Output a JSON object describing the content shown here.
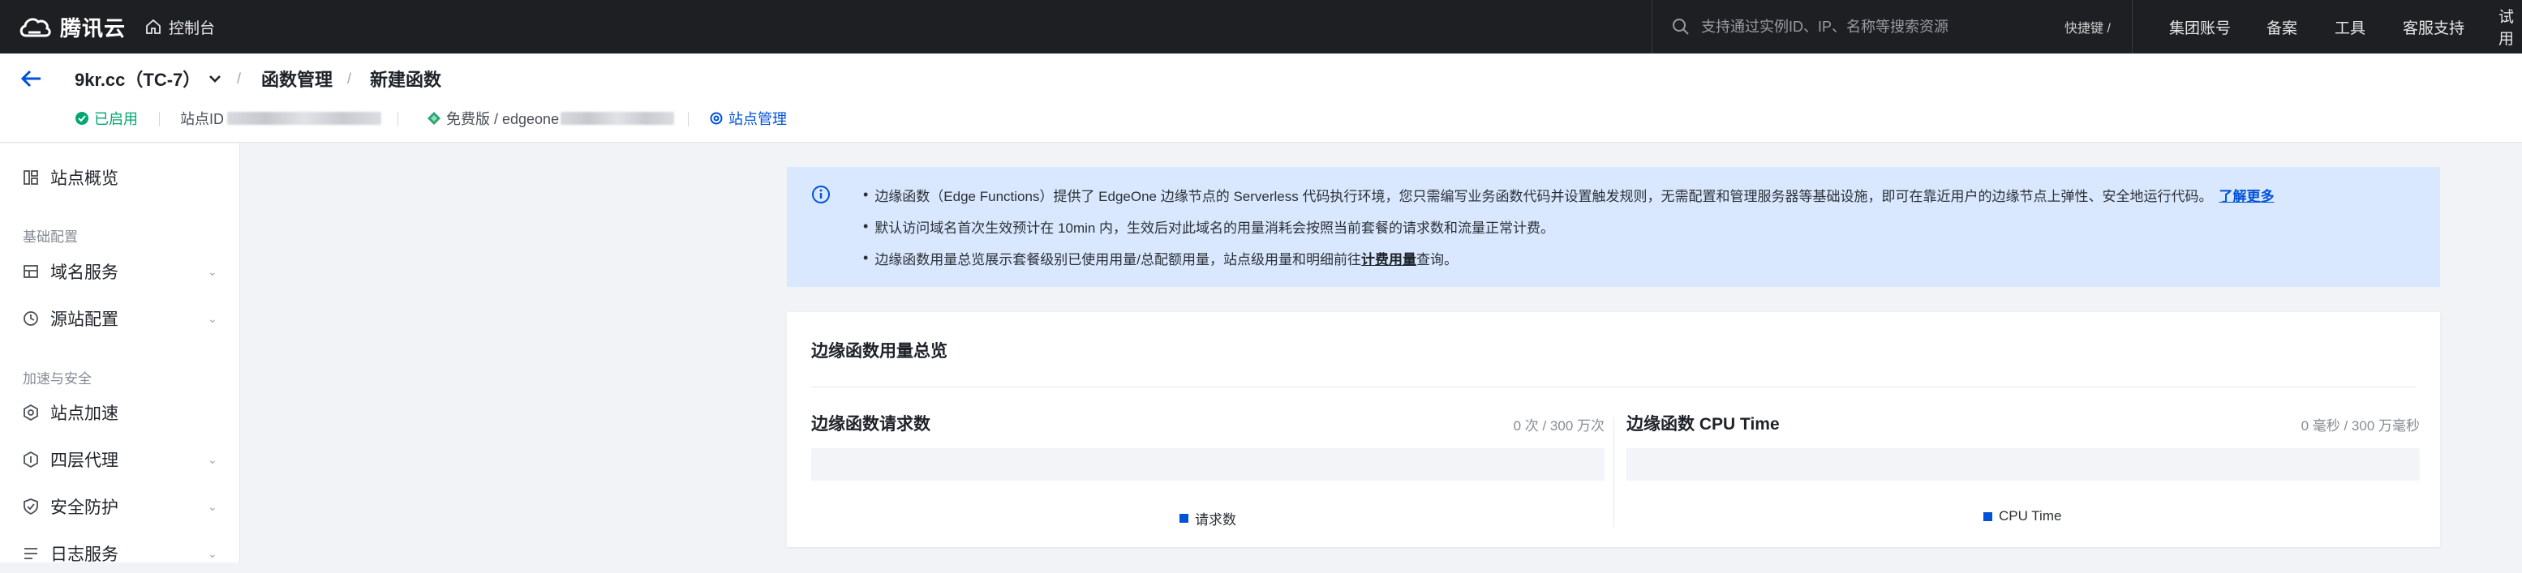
{
  "topbar": {
    "logo_text": "腾讯云",
    "console": "控制台",
    "search_placeholder": "支持通过实例ID、IP、名称等搜索资源",
    "shortcut": "快捷键 /",
    "nav": [
      "集团账号",
      "备案",
      "工具",
      "客服支持",
      "试用"
    ]
  },
  "header": {
    "site_name": "9kr.cc（TC-7）",
    "crumb_1": "函数管理",
    "crumb_2": "新建函数",
    "sep": "/",
    "status": "已启用",
    "site_id_label": "站点ID",
    "plan_label": "免费版 / edgeone",
    "site_manage": "站点管理"
  },
  "sidebar": {
    "overview": "站点概览",
    "group_basic": "基础配置",
    "domain": "域名服务",
    "origin": "源站配置",
    "group_accel": "加速与安全",
    "accel": "站点加速",
    "l4": "四层代理",
    "security": "安全防护",
    "logs": "日志服务"
  },
  "notice": {
    "line1": "边缘函数（Edge Functions）提供了 EdgeOne 边缘节点的 Serverless 代码执行环境，您只需编写业务函数代码并设置触发规则，无需配置和管理服务器等基础设施，即可在靠近用户的边缘节点上弹性、安全地运行代码。",
    "line1_link": "了解更多",
    "line2": "默认访问域名首次生效预计在 10min 内，生效后对此域名的用量消耗会按照当前套餐的请求数和流量正常计费。",
    "line3_a": "边缘函数用量总览展示套餐级别已使用用量/总配额用量，站点级用量和明细前往",
    "line3_link": "计费用量",
    "line3_b": "查询。"
  },
  "usage": {
    "title": "边缘函数用量总览",
    "requests_title": "边缘函数请求数",
    "requests_value": "0 次 / 300 万次",
    "requests_legend": "请求数",
    "cpu_title": "边缘函数 CPU Time",
    "cpu_value": "0 毫秒 / 300 万毫秒",
    "cpu_legend": "CPU Time"
  },
  "colors": {
    "accent": "#0052d9",
    "success": "#00a870",
    "topbar": "#1e1f23",
    "notice_bg": "#d9e8ff"
  }
}
